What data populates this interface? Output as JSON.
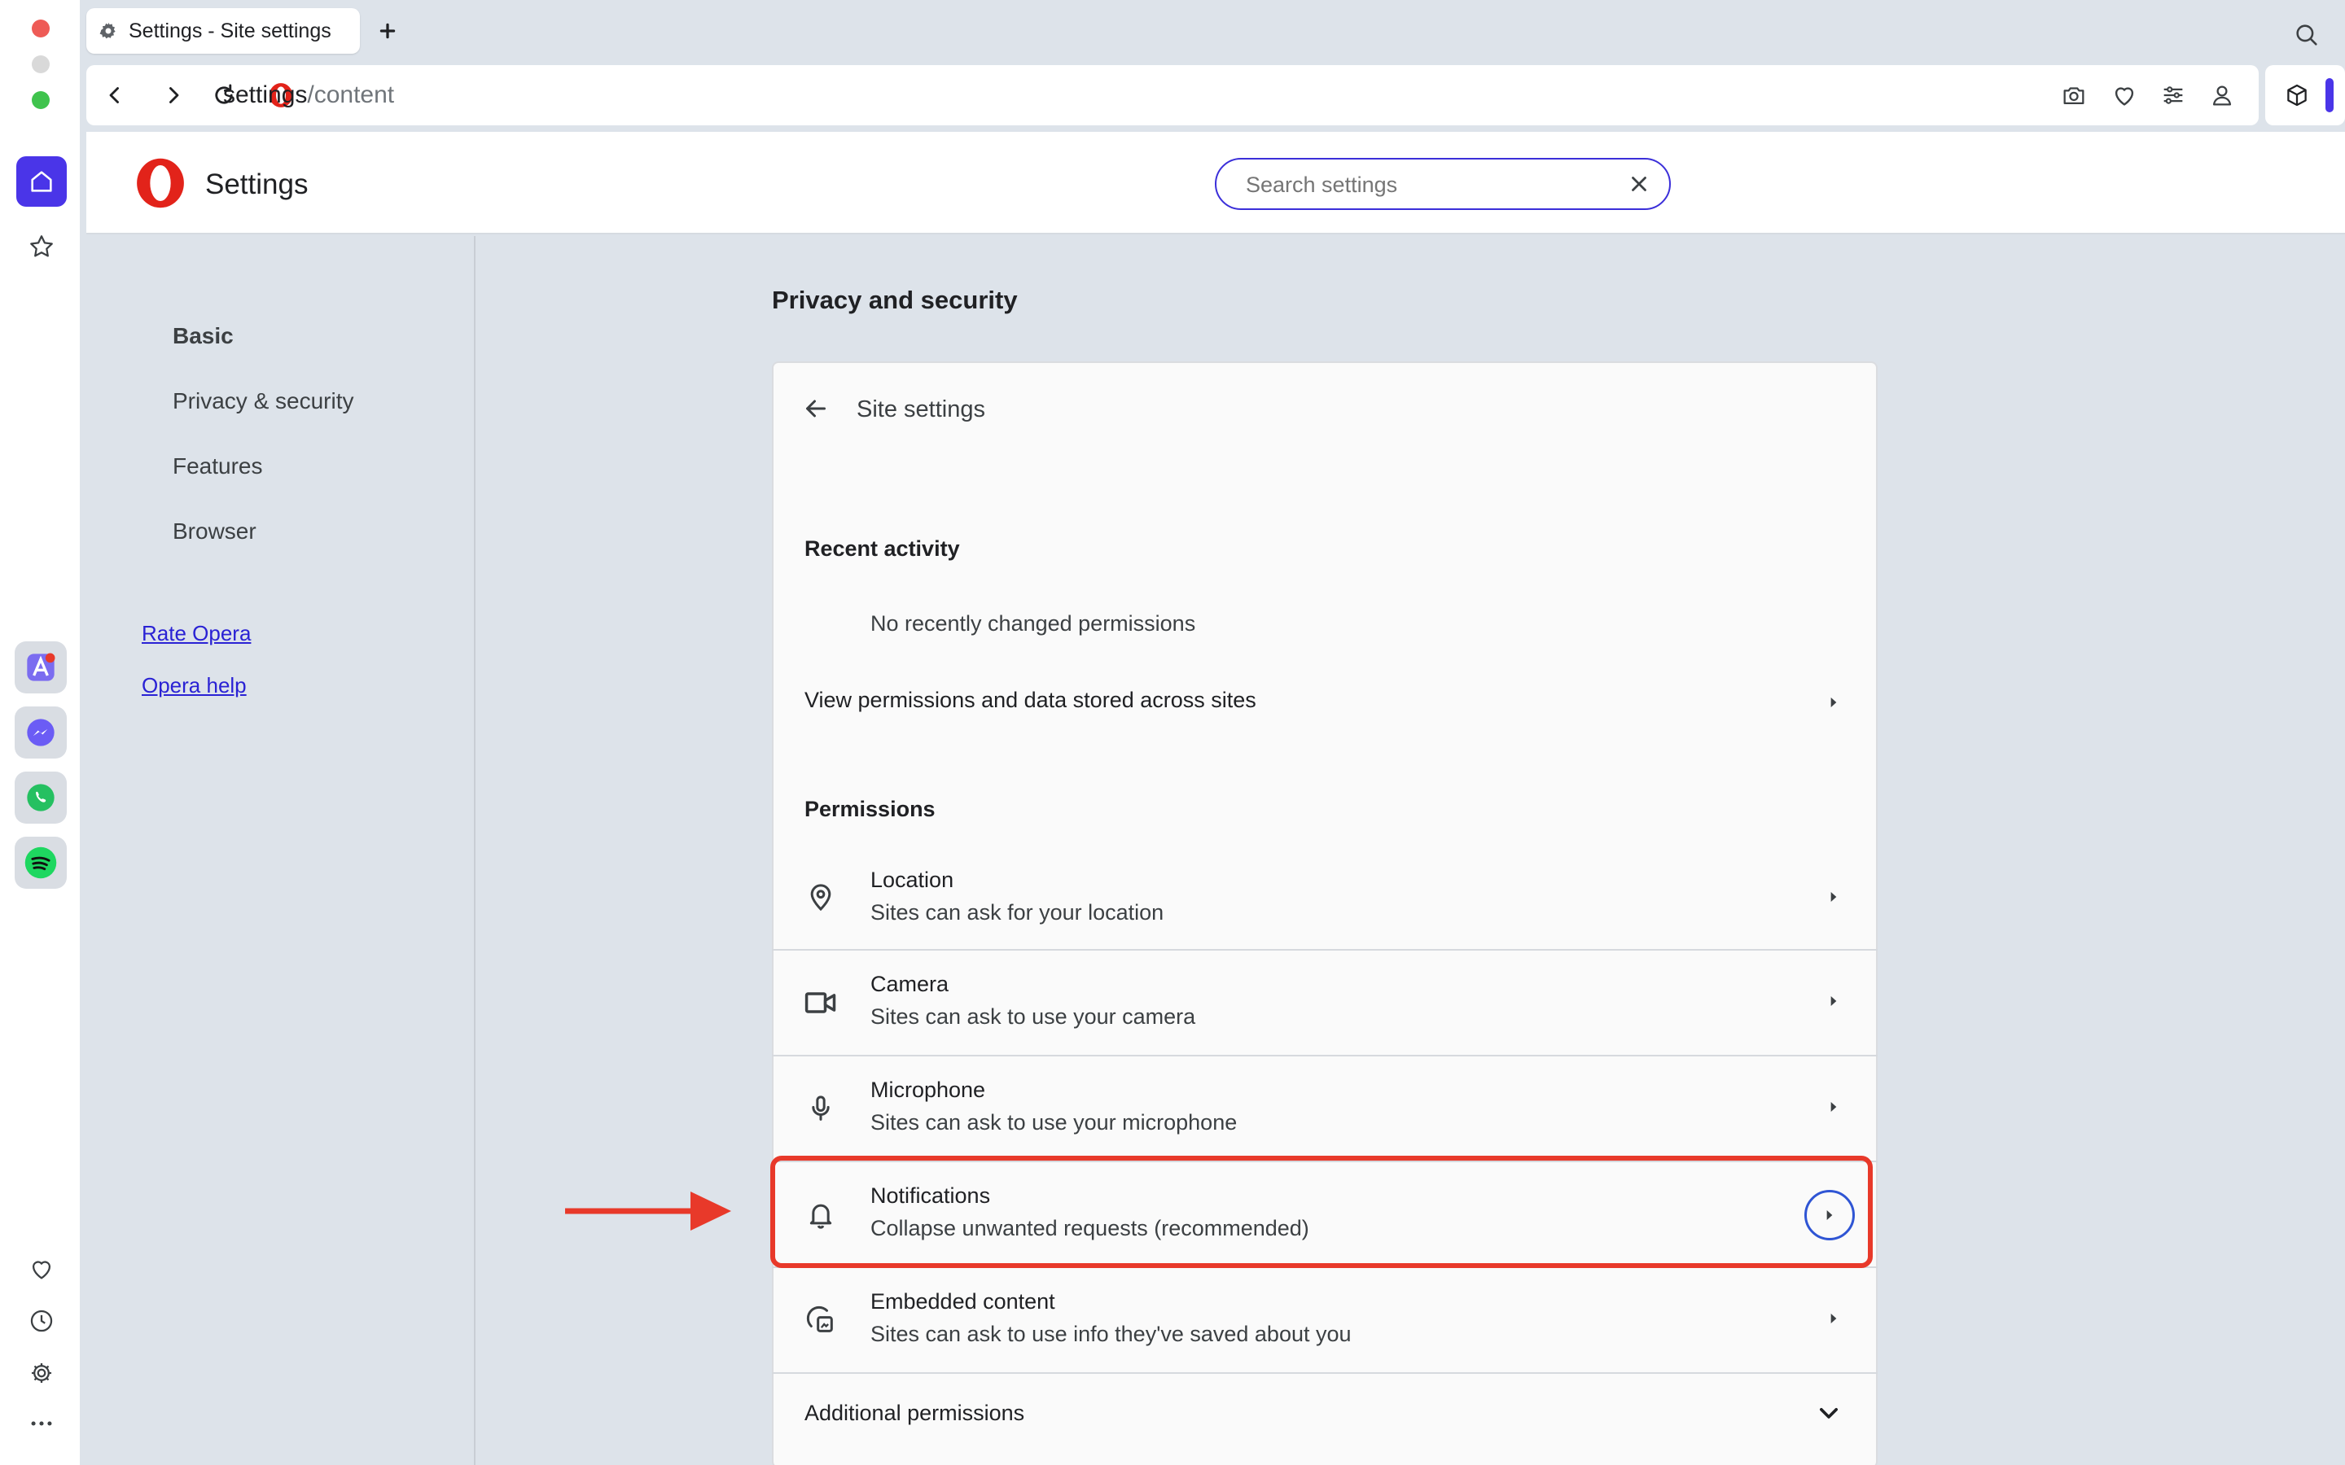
{
  "tab": {
    "title": "Settings - Site settings"
  },
  "addressbar": {
    "url_host": "settings",
    "url_path": "/content"
  },
  "header": {
    "title": "Settings",
    "search_placeholder": "Search settings",
    "search_value": "Search settings"
  },
  "nav": {
    "items": [
      {
        "label": "Basic"
      },
      {
        "label": "Privacy & security"
      },
      {
        "label": "Features"
      },
      {
        "label": "Browser"
      }
    ],
    "links": [
      {
        "label": "Rate Opera"
      },
      {
        "label": "Opera help"
      }
    ]
  },
  "main": {
    "section_title": "Privacy and security",
    "card": {
      "back_title": "Site settings",
      "recent_activity": {
        "heading": "Recent activity",
        "empty_text": "No recently changed permissions",
        "view_all_label": "View permissions and data stored across sites"
      },
      "permissions": {
        "heading": "Permissions",
        "rows": [
          {
            "title": "Location",
            "subtitle": "Sites can ask for your location",
            "icon": "location-pin-icon"
          },
          {
            "title": "Camera",
            "subtitle": "Sites can ask to use your camera",
            "icon": "camera-icon"
          },
          {
            "title": "Microphone",
            "subtitle": "Sites can ask to use your microphone",
            "icon": "microphone-icon"
          },
          {
            "title": "Notifications",
            "subtitle": "Collapse unwanted requests (recommended)",
            "icon": "bell-icon"
          },
          {
            "title": "Embedded content",
            "subtitle": "Sites can ask to use info they've saved about you",
            "icon": "embedded-content-icon"
          }
        ]
      },
      "additional_permissions_label": "Additional permissions"
    }
  },
  "colors": {
    "accent": "#3b2fd9",
    "highlight": "#e8392a",
    "focus_ring": "#2f55d4",
    "opera_red": "#e2231a"
  }
}
